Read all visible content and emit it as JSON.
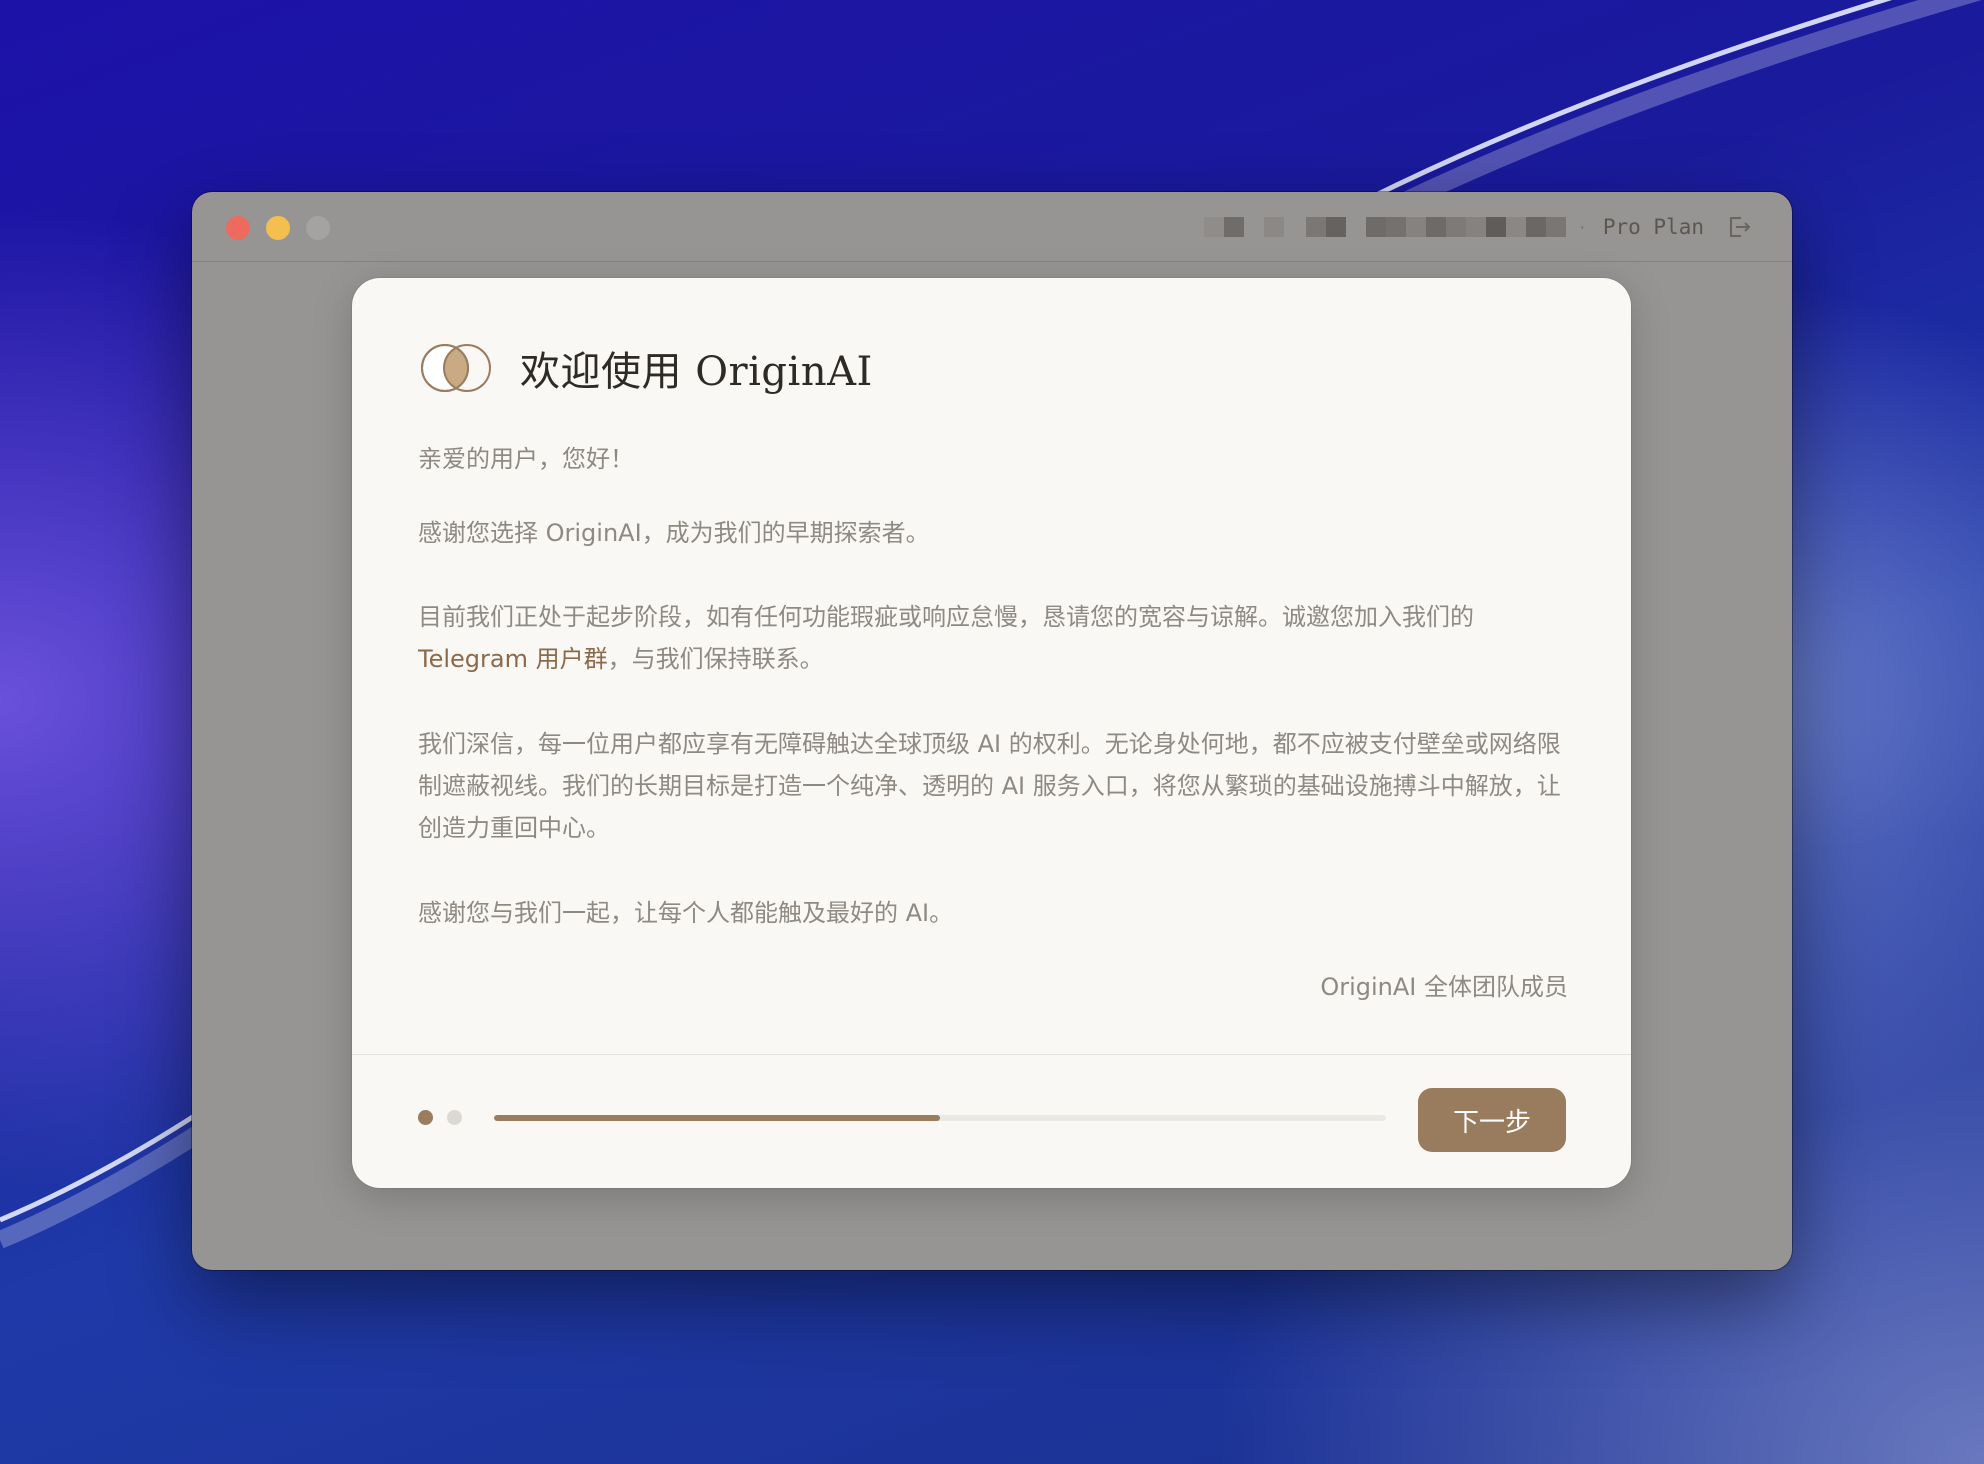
{
  "window": {
    "account_dot": "·",
    "plan": "Pro Plan"
  },
  "icons": {
    "logo": "origin-logo-icon",
    "logout": "logout-icon"
  },
  "welcome": {
    "title": "欢迎使用 OriginAI",
    "greeting": "亲爱的用户，您好！",
    "thanks": "感谢您选择 OriginAI，成为我们的早期探索者。",
    "status_text": "目前我们正处于起步阶段，如有任何功能瑕疵或响应怠慢，恳请您的宽容与谅解。诚邀您加入我们的",
    "telegram_link": "Telegram 用户群",
    "status_suffix": "，与我们保持联系。",
    "belief": "我们深信，每一位用户都应享有无障碍触达全球顶级 AI 的权利。无论身处何地，都不应被支付壁垒或网络限制遮蔽视线。我们的长期目标是打造一个纯净、透明的 AI 服务入口，将您从繁琐的基础设施搏斗中解放，让创造力重回中心。",
    "closing": "感谢您与我们一起，让每个人都能触及最好的 AI。",
    "signature": "OriginAI 全体团队成员"
  },
  "footer": {
    "steps_total": 2,
    "current_step": 1,
    "progress": 0.5,
    "next_label": "下一步"
  },
  "colors": {
    "accent": "#997b5d",
    "link": "#8c6a49",
    "modal_bg": "#f9f8f5",
    "window_bg": "#979593"
  }
}
